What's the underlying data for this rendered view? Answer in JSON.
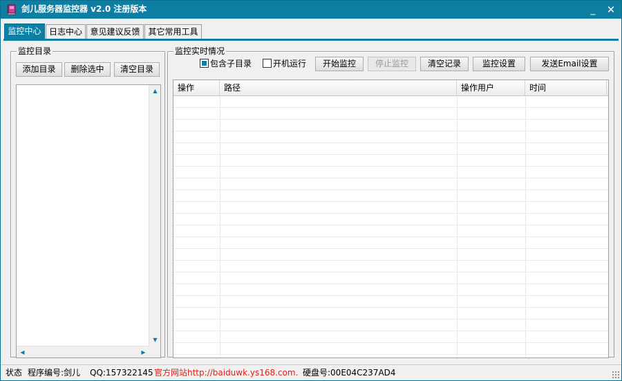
{
  "window": {
    "title": "剑儿服务器监控器 v2.0  注册版本",
    "minimize_glyph": "_",
    "close_glyph": "✕"
  },
  "tabs": [
    {
      "label": "监控中心",
      "active": true
    },
    {
      "label": "日志中心",
      "active": false
    },
    {
      "label": "意见建议反馈",
      "active": false
    },
    {
      "label": "其它常用工具",
      "active": false
    }
  ],
  "dir_panel": {
    "title": "监控目录",
    "add_label": "添加目录",
    "delete_label": "删除选中",
    "clear_label": "清空目录"
  },
  "monitor_panel": {
    "title": "监控实时情况",
    "include_subdirs_label": "包含子目录",
    "include_subdirs_checked": true,
    "autostart_label": "开机运行",
    "autostart_checked": false,
    "start_label": "开始监控",
    "stop_label": "停止监控",
    "clear_records_label": "清空记录",
    "settings_label": "监控设置",
    "email_settings_label": "发送Email设置",
    "columns": [
      "操作",
      "路径",
      "操作用户",
      "时间"
    ],
    "rows": []
  },
  "statusbar": {
    "status_label": "状态",
    "program_id": "程序编号:剑儿",
    "qq": "QQ:157322145",
    "website": "官方网站http://baiduwk.ys168.com.",
    "disk_id": "硬盘号:00E04C237AD4"
  },
  "colors": {
    "accent": "#0f7ea3",
    "link": "#e0201a"
  }
}
